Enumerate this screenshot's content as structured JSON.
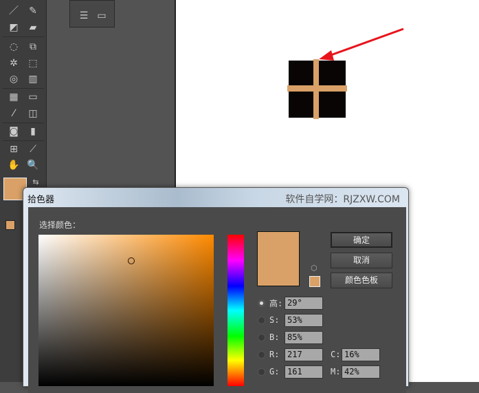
{
  "dialog": {
    "title": "拾色器",
    "watermark": "软件自学网：RJZXW.COM",
    "select_label": "选择颜色：",
    "buttons": {
      "ok": "确定",
      "cancel": "取消",
      "swatches": "颜色色板"
    },
    "fields": [
      {
        "label": "高:",
        "value": "29°",
        "checked": true
      },
      {
        "label": "S:",
        "value": "53%"
      },
      {
        "label": "B:",
        "value": "85%"
      },
      {
        "label": "R:",
        "value": "217"
      },
      {
        "label": "G:",
        "value": "161"
      }
    ],
    "cmyk": [
      {
        "label": "C:",
        "value": "16%"
      },
      {
        "label": "M:",
        "value": "42%"
      }
    ],
    "current_color": "#d9a167"
  },
  "colors": {
    "fill": "#d9a167",
    "shape": "#0a0505",
    "arrow": "#e8141c"
  }
}
